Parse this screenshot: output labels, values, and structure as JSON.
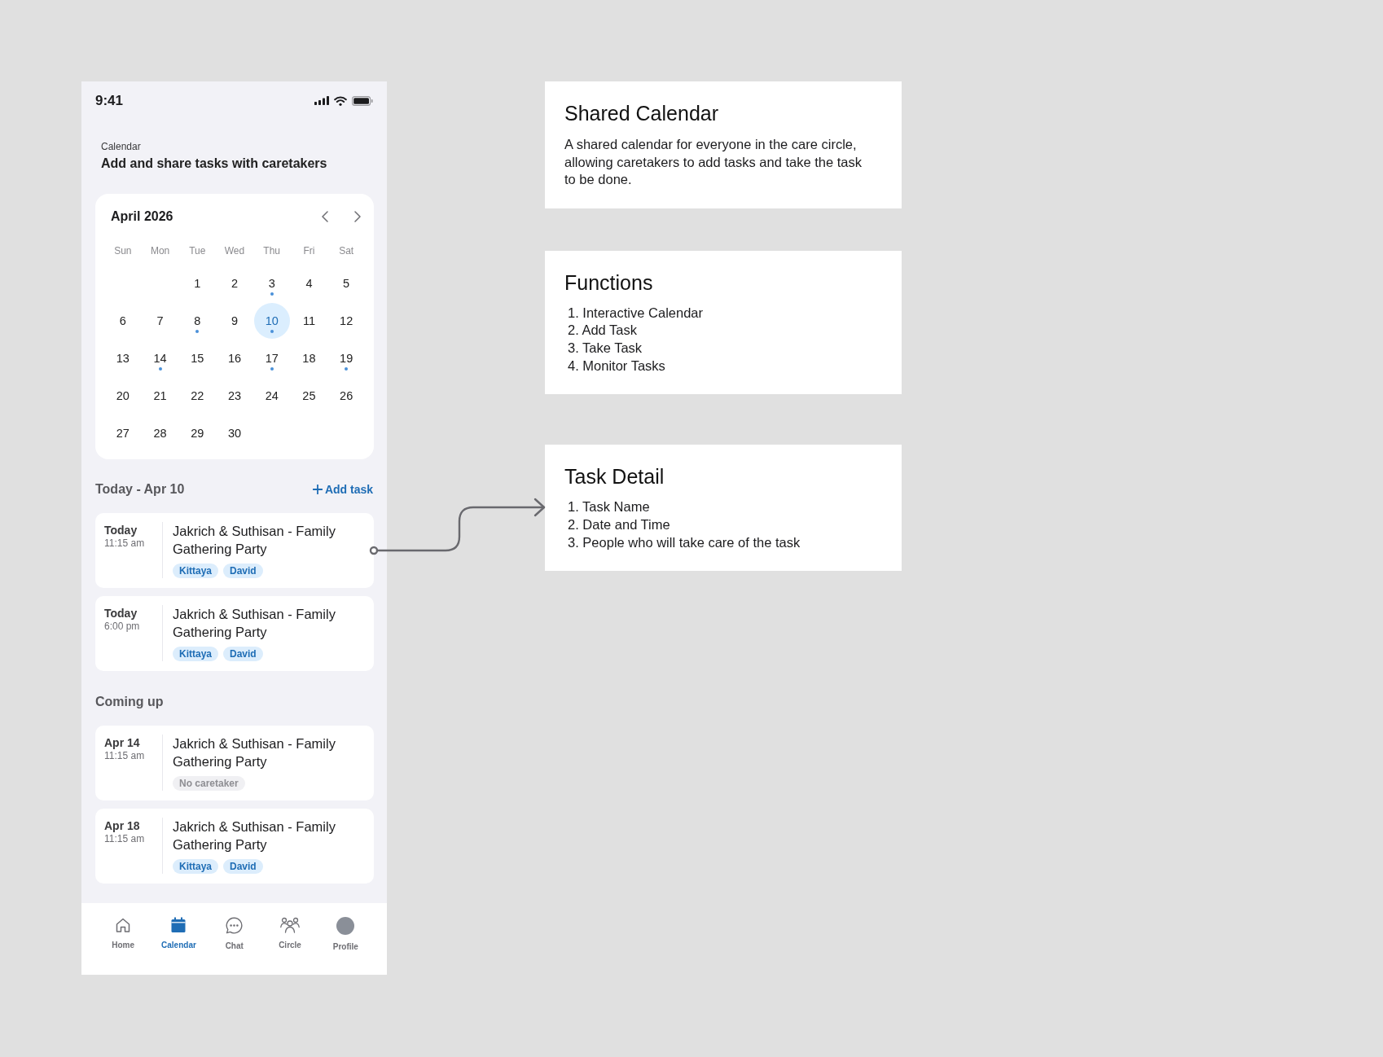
{
  "status_bar": {
    "time": "9:41"
  },
  "header": {
    "label": "Calendar",
    "title": "Add and share tasks with caretakers"
  },
  "calendar": {
    "month": "April 2026",
    "weekdays": [
      "Sun",
      "Mon",
      "Tue",
      "Wed",
      "Thu",
      "Fri",
      "Sat"
    ],
    "weeks": [
      [
        {
          "day": "1",
          "selected": false,
          "has_task": false
        },
        {
          "day": "2",
          "selected": false,
          "has_task": false
        },
        {
          "day": "3",
          "selected": false,
          "has_task": true
        },
        {
          "day": "4",
          "selected": false,
          "has_task": false
        },
        {
          "day": "5",
          "selected": false,
          "has_task": false
        }
      ],
      [
        {
          "day": "6",
          "selected": false,
          "has_task": false
        },
        {
          "day": "7",
          "selected": false,
          "has_task": false
        },
        {
          "day": "8",
          "selected": false,
          "has_task": true
        },
        {
          "day": "9",
          "selected": false,
          "has_task": false
        },
        {
          "day": "10",
          "selected": true,
          "has_task": true
        },
        {
          "day": "11",
          "selected": false,
          "has_task": false
        },
        {
          "day": "12",
          "selected": false,
          "has_task": false
        }
      ],
      [
        {
          "day": "13",
          "selected": false,
          "has_task": false
        },
        {
          "day": "14",
          "selected": false,
          "has_task": true
        },
        {
          "day": "15",
          "selected": false,
          "has_task": false
        },
        {
          "day": "16",
          "selected": false,
          "has_task": false
        },
        {
          "day": "17",
          "selected": false,
          "has_task": true
        },
        {
          "day": "18",
          "selected": false,
          "has_task": false
        },
        {
          "day": "19",
          "selected": false,
          "has_task": true
        }
      ],
      [
        {
          "day": "20",
          "selected": false,
          "has_task": false
        },
        {
          "day": "21",
          "selected": false,
          "has_task": false
        },
        {
          "day": "22",
          "selected": false,
          "has_task": false
        },
        {
          "day": "23",
          "selected": false,
          "has_task": false
        },
        {
          "day": "24",
          "selected": false,
          "has_task": false
        },
        {
          "day": "25",
          "selected": false,
          "has_task": false
        },
        {
          "day": "26",
          "selected": false,
          "has_task": false
        }
      ],
      [
        {
          "day": "27",
          "selected": false,
          "has_task": false
        },
        {
          "day": "28",
          "selected": false,
          "has_task": false
        },
        {
          "day": "29",
          "selected": false,
          "has_task": false
        },
        {
          "day": "30",
          "selected": false,
          "has_task": false
        }
      ]
    ]
  },
  "sections": [
    {
      "title": "Today - Apr 10",
      "add_action": "Add task",
      "tasks": [
        {
          "date": "Today",
          "time": "11:15 am",
          "title": "Jakrich & Suthisan - Family Gathering Party",
          "tags": [
            {
              "label": "Kittaya",
              "kind": "person"
            },
            {
              "label": "David",
              "kind": "person"
            }
          ]
        },
        {
          "date": "Today",
          "time": "6:00 pm",
          "title": "Jakrich & Suthisan - Family Gathering Party",
          "tags": [
            {
              "label": "Kittaya",
              "kind": "person"
            },
            {
              "label": "David",
              "kind": "person"
            }
          ]
        }
      ]
    },
    {
      "title": "Coming up",
      "tasks": [
        {
          "date": "Apr 14",
          "time": "11:15 am",
          "title": "Jakrich & Suthisan - Family Gathering Party",
          "tags": [
            {
              "label": "No caretaker",
              "kind": "none"
            }
          ]
        },
        {
          "date": "Apr 18",
          "time": "11:15 am",
          "title": "Jakrich & Suthisan - Family Gathering Party",
          "tags": [
            {
              "label": "Kittaya",
              "kind": "person"
            },
            {
              "label": "David",
              "kind": "person"
            }
          ]
        }
      ]
    }
  ],
  "nav": [
    {
      "label": "Home",
      "selected": false
    },
    {
      "label": "Calendar",
      "selected": true
    },
    {
      "label": "Chat",
      "selected": false
    },
    {
      "label": "Circle",
      "selected": false
    },
    {
      "label": "Profile",
      "selected": false
    }
  ],
  "notes": [
    {
      "kind": "paragraph",
      "title": "Shared Calendar",
      "text": "A shared calendar for everyone in the care circle, allowing caretakers to add tasks and take the task to be done."
    },
    {
      "kind": "list",
      "title": "Functions",
      "items": [
        "1. Interactive Calendar",
        "2. Add Task",
        "3. Take Task",
        "4. Monitor Tasks"
      ]
    },
    {
      "kind": "list",
      "title": "Task Detail",
      "items": [
        "1. Task Name",
        "2. Date and Time",
        "3. People who will take care of the task"
      ]
    }
  ]
}
